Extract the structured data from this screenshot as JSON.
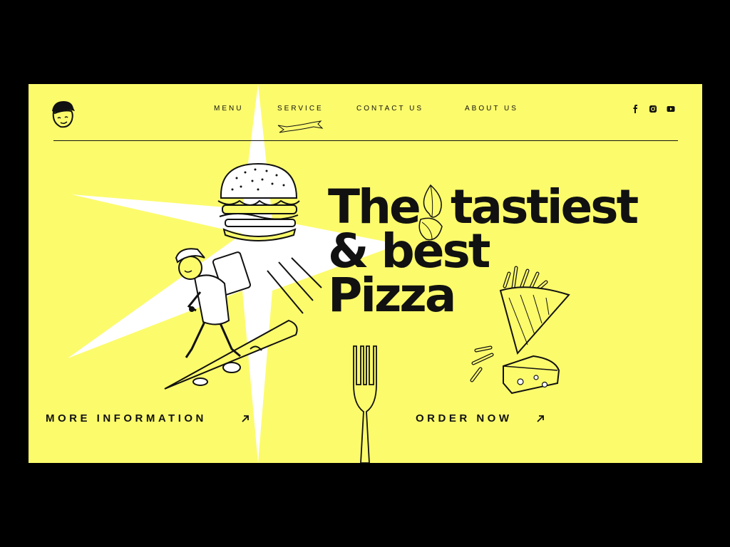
{
  "nav": {
    "items": [
      {
        "label": "MENU"
      },
      {
        "label": "SERVICE"
      },
      {
        "label": "CONTACT US"
      },
      {
        "label": "ABOUT US"
      }
    ]
  },
  "social": {
    "icons": [
      "facebook-icon",
      "instagram-icon",
      "youtube-icon"
    ]
  },
  "hero": {
    "line1a": "The",
    "line1b": "tastiest",
    "line2": "& best",
    "line3": "Pizza"
  },
  "cta": {
    "more_info": "MORE INFORMATION",
    "order_now": "ORDER NOW"
  },
  "colors": {
    "background": "#fcfb6c",
    "frame": "#000000",
    "ink": "#111111",
    "star": "#ffffff"
  }
}
